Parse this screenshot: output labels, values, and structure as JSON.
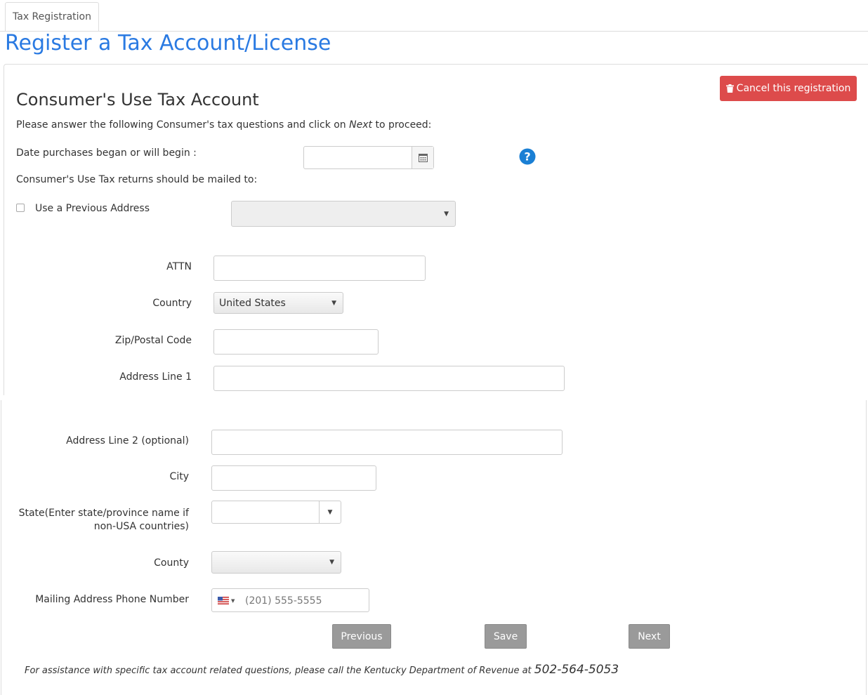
{
  "tab": {
    "label": "Tax Registration"
  },
  "page": {
    "title": "Register a Tax Account/License"
  },
  "cancel": {
    "label": "Cancel this registration"
  },
  "section": {
    "title": "Consumer's Use Tax Account",
    "instructions_prefix": "Please answer the following Consumer's tax questions and click on ",
    "instructions_em": "Next",
    "instructions_suffix": " to proceed:"
  },
  "fields": {
    "date_label": "Date purchases began or will begin :",
    "mailed_label": "Consumer's Use Tax returns should be mailed to:",
    "prev_address_label": "Use a Previous Address",
    "attn_label": "ATTN",
    "country_label": "Country",
    "country_value": "United States",
    "zip_label": "Zip/Postal Code",
    "addr1_label": "Address Line 1",
    "addr2_label": "Address Line 2 (optional)",
    "city_label": "City",
    "state_label_1": "State(Enter state/province name if",
    "state_label_2": "non-USA countries)",
    "county_label": "County",
    "phone_label": "Mailing Address Phone Number",
    "phone_placeholder": "(201) 555-5555"
  },
  "buttons": {
    "previous": "Previous",
    "save": "Save",
    "next": "Next"
  },
  "footer": {
    "text": "For assistance with specific tax account related questions, please call the Kentucky Department of Revenue at ",
    "phone": "502-564-5053"
  },
  "colors": {
    "accent": "#2a7ae2",
    "danger": "#dd4b4b",
    "help_icon": "#1a7fd4",
    "disabled_button": "#9a9a9a"
  }
}
